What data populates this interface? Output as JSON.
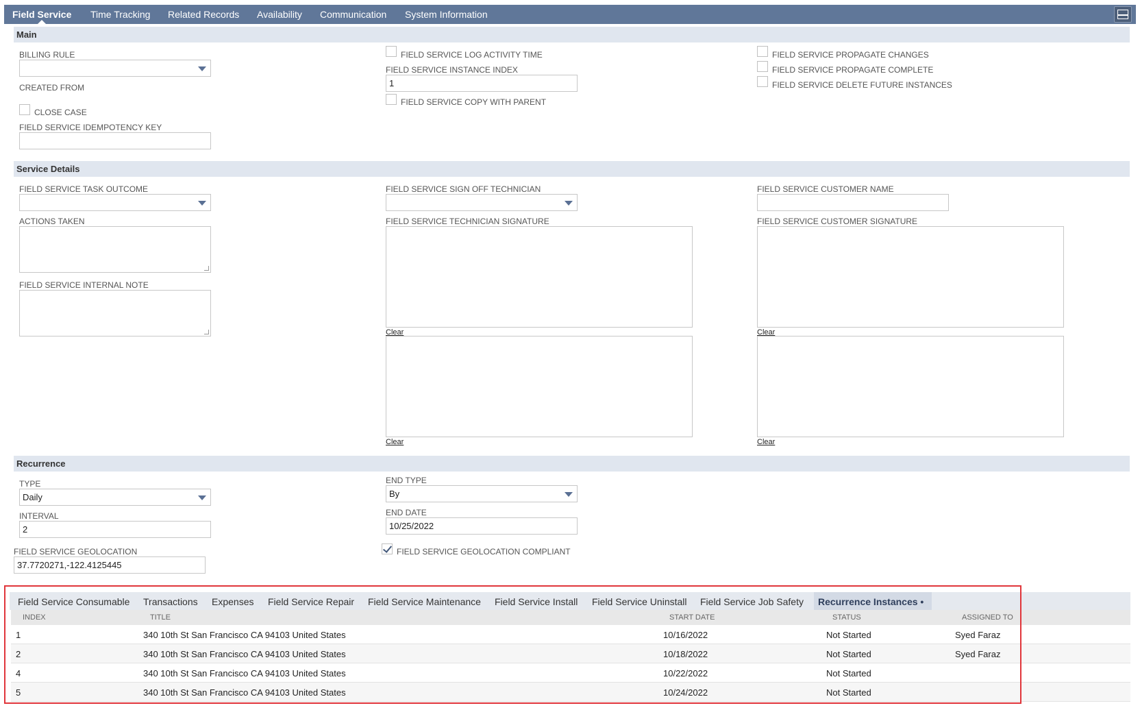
{
  "top_tabs": {
    "field_service": "Field Service",
    "time_tracking": "Time Tracking",
    "related_records": "Related Records",
    "availability": "Availability",
    "communication": "Communication",
    "system_information": "System Information"
  },
  "main": {
    "title": "Main",
    "billing_rule_label": "BILLING RULE",
    "billing_rule_value": "",
    "created_from_label": "CREATED FROM",
    "close_case_label": "CLOSE CASE",
    "close_case_checked": false,
    "idempotency_key_label": "FIELD SERVICE IDEMPOTENCY KEY",
    "idempotency_key_value": "",
    "log_activity_time_label": "FIELD SERVICE LOG ACTIVITY TIME",
    "instance_index_label": "FIELD SERVICE INSTANCE INDEX",
    "instance_index_value": "1",
    "copy_with_parent_label": "FIELD SERVICE COPY WITH PARENT",
    "propagate_changes_label": "FIELD SERVICE PROPAGATE CHANGES",
    "propagate_complete_label": "FIELD SERVICE PROPAGATE COMPLETE",
    "delete_future_label": "FIELD SERVICE DELETE FUTURE INSTANCES"
  },
  "service_details": {
    "title": "Service Details",
    "task_outcome_label": "FIELD SERVICE TASK OUTCOME",
    "actions_taken_label": "ACTIONS TAKEN",
    "internal_note_label": "FIELD SERVICE INTERNAL NOTE",
    "sign_off_technician_label": "FIELD SERVICE SIGN OFF TECHNICIAN",
    "technician_signature_label": "FIELD SERVICE TECHNICIAN SIGNATURE",
    "customer_name_label": "FIELD SERVICE CUSTOMER NAME",
    "customer_signature_label": "FIELD SERVICE CUSTOMER SIGNATURE",
    "clear_label": "Clear"
  },
  "recurrence": {
    "title": "Recurrence",
    "type_label": "TYPE",
    "type_value": "Daily",
    "interval_label": "INTERVAL",
    "interval_value": "2",
    "end_type_label": "END TYPE",
    "end_type_value": "By",
    "end_date_label": "END DATE",
    "end_date_value": "10/25/2022",
    "geolocation_label": "FIELD SERVICE GEOLOCATION",
    "geolocation_value": "37.7720271,-122.4125445",
    "geolocation_compliant_label": "FIELD SERVICE GEOLOCATION COMPLIANT",
    "geolocation_compliant_checked": true
  },
  "sublist": {
    "tabs": {
      "consumable": "Field Service Consumable",
      "transactions": "Transactions",
      "expenses": "Expenses",
      "repair": "Field Service Repair",
      "maintenance": "Field Service Maintenance",
      "install": "Field Service Install",
      "uninstall": "Field Service Uninstall",
      "job_safety": "Field Service Job Safety",
      "recurrence_instances": "Recurrence Instances •"
    },
    "columns": {
      "index": "INDEX",
      "title": "TITLE",
      "start_date": "START DATE",
      "status": "STATUS",
      "assigned_to": "ASSIGNED TO"
    },
    "rows": [
      {
        "index": "1",
        "title": "340 10th St San Francisco CA 94103 United States",
        "start_date": "10/16/2022",
        "status": "Not Started",
        "assigned_to": "Syed Faraz"
      },
      {
        "index": "2",
        "title": "340 10th St San Francisco CA 94103 United States",
        "start_date": "10/18/2022",
        "status": "Not Started",
        "assigned_to": "Syed Faraz"
      },
      {
        "index": "4",
        "title": "340 10th St San Francisco CA 94103 United States",
        "start_date": "10/22/2022",
        "status": "Not Started",
        "assigned_to": ""
      },
      {
        "index": "5",
        "title": "340 10th St San Francisco CA 94103 United States",
        "start_date": "10/24/2022",
        "status": "Not Started",
        "assigned_to": ""
      }
    ]
  },
  "colors": {
    "tab_bar": "#607799",
    "section_header": "#e0e6ef",
    "highlight_outline": "#e0353a"
  }
}
